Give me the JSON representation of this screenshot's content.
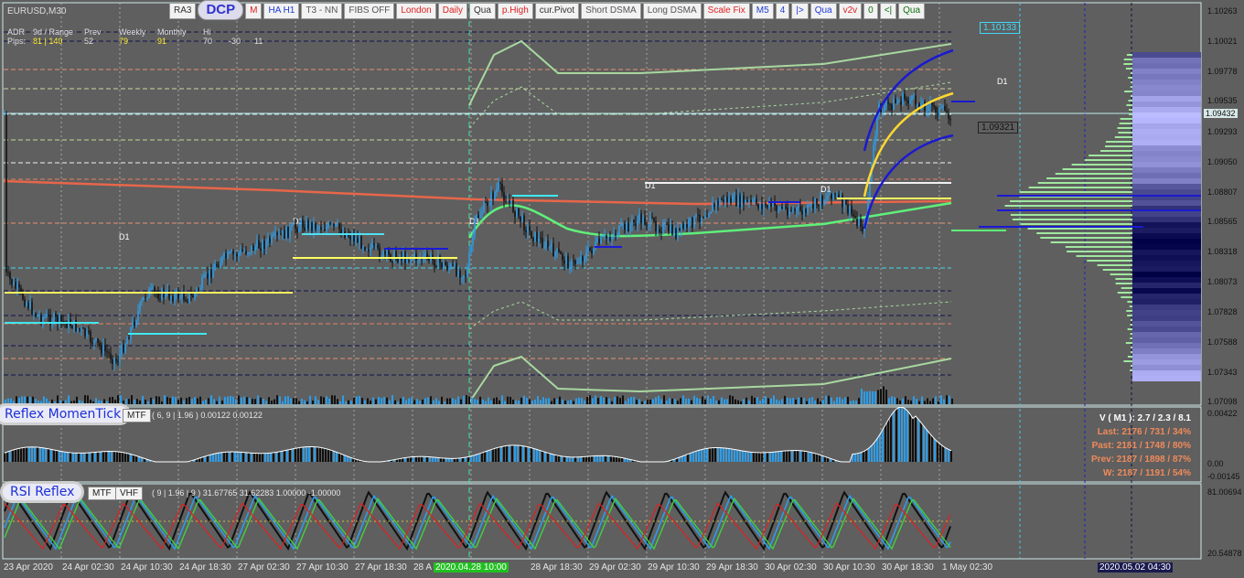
{
  "symbol": "EURUSD,M30",
  "toolbar": {
    "buttons": [
      {
        "label": "RA3",
        "style": "dark"
      },
      {
        "label": "DCP",
        "style": "big"
      },
      {
        "label": "M",
        "style": "red"
      },
      {
        "label": "HA H1",
        "style": "blue"
      },
      {
        "label": "T3 - NN",
        "style": "gray"
      },
      {
        "label": "FIBS OFF",
        "style": "gray"
      },
      {
        "label": "London",
        "style": "red"
      },
      {
        "label": "Daily",
        "style": "red"
      },
      {
        "label": "Qua",
        "style": "dark"
      },
      {
        "label": "p.High",
        "style": "red"
      },
      {
        "label": "cur.Pivot",
        "style": "dark"
      },
      {
        "label": "Short DSMA",
        "style": "gray"
      },
      {
        "label": "Long DSMA",
        "style": "gray"
      },
      {
        "label": "Scale Fix",
        "style": "red"
      },
      {
        "label": "M5",
        "style": "blue"
      },
      {
        "label": "4",
        "style": "blue"
      },
      {
        "label": "|>",
        "style": "blue"
      },
      {
        "label": "Qua",
        "style": "blue"
      },
      {
        "label": "v2v",
        "style": "red"
      },
      {
        "label": "0",
        "style": "green"
      },
      {
        "label": "<|",
        "style": "green"
      },
      {
        "label": "Qua",
        "style": "green"
      }
    ]
  },
  "adr": {
    "adr_label": "ADR",
    "range_label": "9d / Range",
    "prev_label": "Prev",
    "weekly_label": "Weekly",
    "monthly_label": "Monthly",
    "pips_label": "Pips:",
    "range_value": "81 | 140",
    "prev_value": "52",
    "weekly_value": "79",
    "monthly_value": "91",
    "extra1": "70",
    "extra2": "-30",
    "extra3": "11",
    "hi_label": "Hi"
  },
  "price_axis": [
    "1.10263",
    "1.10021",
    "1.09778",
    "1.09535",
    "1.09432",
    "1.09293",
    "1.09050",
    "1.08807",
    "1.08565",
    "1.08318",
    "1.08073",
    "1.07828",
    "1.07588",
    "1.07343",
    "1.07098"
  ],
  "price_boxes": {
    "top": "1.10133",
    "mid": "1.09321"
  },
  "d1_label": "D1",
  "time_axis": [
    "23 Apr 2020",
    "24 Apr 02:30",
    "24 Apr 10:30",
    "24 Apr 18:30",
    "27 Apr 02:30",
    "27 Apr 10:30",
    "27 Apr 18:30",
    "28 A",
    "2020.04.28 10:00",
    "28 Apr 18:30",
    "29 Apr 02:30",
    "29 Apr 10:30",
    "29 Apr 18:30",
    "30 Apr 02:30",
    "30 Apr 10:30",
    "30 Apr 18:30",
    "1 May 02:30",
    "2020.05.02 04:30"
  ],
  "momentum": {
    "name": "Reflex MomenTick",
    "mtf": "MTF",
    "params": "( 6, 9 | 1.96 ) 0.00122 0.00122",
    "axis": [
      "0.00422",
      "0.00",
      "-0.00145"
    ]
  },
  "rsi": {
    "name": "RSI Reflex",
    "mtf": "MTF",
    "vhf": "VHF",
    "params": "( 9 | 1.96 | 9 ) 31.67765 31.62283 1.00000 -1.00000",
    "axis": [
      "81.00694",
      "20.54878"
    ]
  },
  "stats": {
    "v": "V ( M1 ): 2.7 / 2.3 / 8.1",
    "last": "Last: 2176 / 731 / 34%",
    "past": "Past: 2181 / 1748 / 80%",
    "prev": "Prev: 2187 / 1898 / 87%",
    "w": "W: 2187 / 1191 / 54%"
  },
  "colors": {
    "bg": "#5f5f5f",
    "bull": "#2d9de8",
    "bear": "#111111",
    "ma_red": "#e8664a",
    "ma_green": "#5ff07a",
    "band_green": "#a8d8a0",
    "yellow": "#ffd830",
    "blue": "#1a1ad8",
    "cyan": "#40e8f0"
  }
}
